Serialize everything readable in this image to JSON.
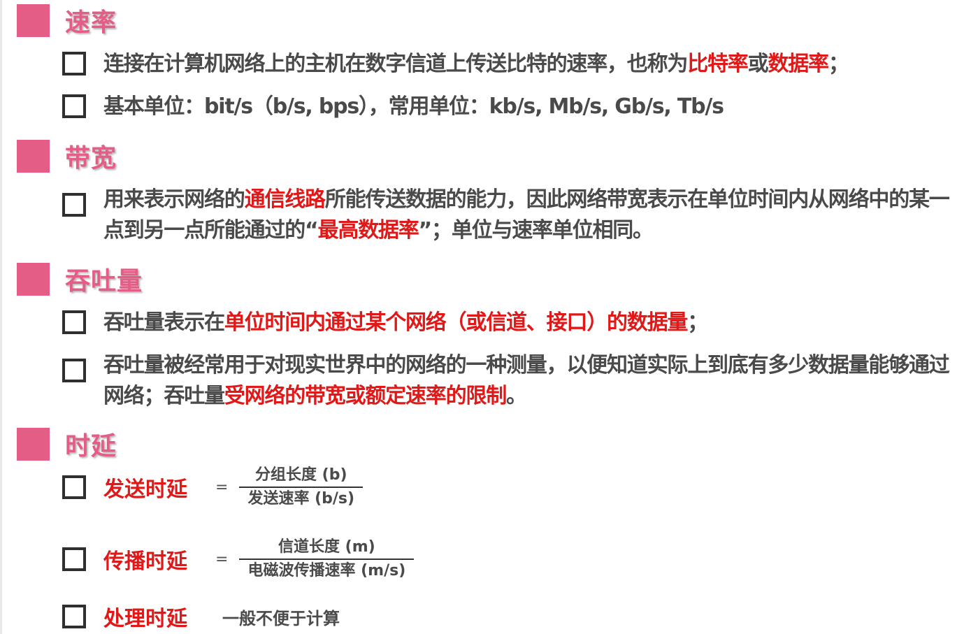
{
  "sections": {
    "rate": {
      "title": "速率",
      "items": [
        {
          "t1": "连接在计算机网络上的主机在数字信道上传送比特的速率，也称为",
          "r1": "比特率",
          "t2": "或",
          "r2": "数据率",
          "t3": "；"
        },
        {
          "t1": "基本单位：bit/s（b/s, bps），常用单位：kb/s, Mb/s, Gb/s, Tb/s"
        }
      ]
    },
    "bandwidth": {
      "title": "带宽",
      "items": [
        {
          "t1": "用来表示网络的",
          "r1": "通信线路",
          "t2": "所能传送数据的能力，因此网络带宽表示在单位时间内从网络中的某一点到另一点所能通过的“",
          "r2": "最高数据率",
          "t3": "”；单位与速率单位相同。"
        }
      ]
    },
    "throughput": {
      "title": "吞吐量",
      "items": [
        {
          "t1": "吞吐量表示在",
          "r1": "单位时间内通过某个网络（或信道、接口）的数据量",
          "t2": "；"
        },
        {
          "t1": "吞吐量被经常用于对现实世界中的网络的一种测量，以便知道实际上到底有多少数据量能够通过网络；吞吐量",
          "r1": "受网络的带宽或额定速率的限制",
          "t2": "。"
        }
      ]
    },
    "delay": {
      "title": "时延",
      "items": [
        {
          "label": "发送时延",
          "eq": "=",
          "numerator": "分组长度 (b)",
          "denominator": "发送速率 (b/s)"
        },
        {
          "label": "传播时延",
          "eq": "=",
          "numerator": "信道长度 (m)",
          "denominator": "电磁波传播速率 (m/s)"
        },
        {
          "label": "处理时延",
          "note": "一般不便于计算"
        }
      ]
    }
  },
  "colors": {
    "accent": "#e45d86",
    "highlight": "#e01818",
    "text": "#4a4a4a"
  }
}
